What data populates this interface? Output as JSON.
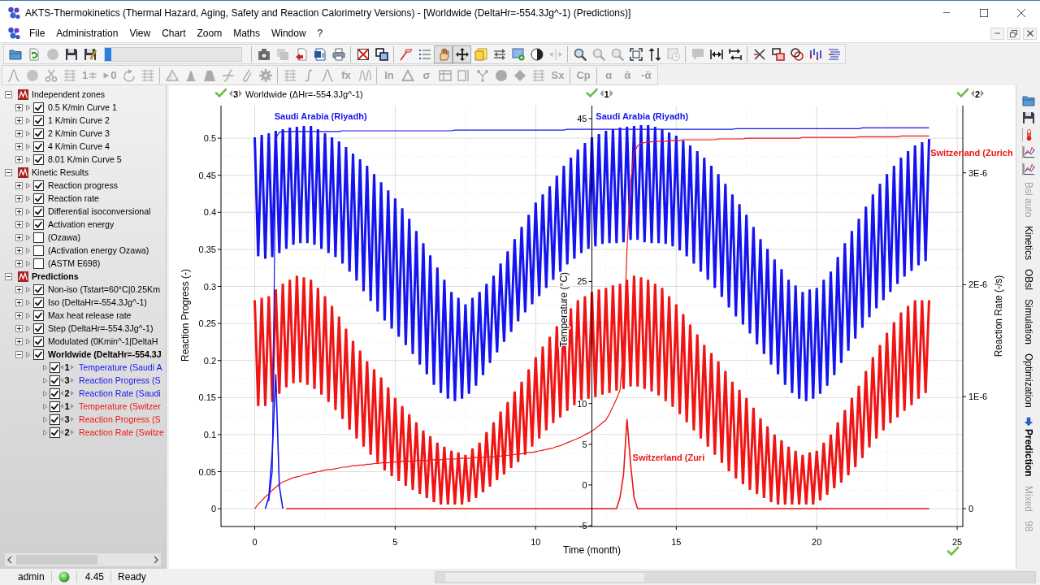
{
  "window": {
    "title": "AKTS-Thermokinetics (Thermal Hazard, Aging, Safety and Reaction Calorimetry Versions) - [Worldwide (DeltaHr=-554.3Jg^-1) (Predictions)]"
  },
  "menu": [
    "File",
    "Administration",
    "View",
    "Chart",
    "Zoom",
    "Maths",
    "Window",
    "?"
  ],
  "toolbars": [
    {
      "groups": [
        {
          "items": [
            {
              "kind": "icon",
              "disabled": false,
              "pressed": false
            },
            {
              "kind": "icon",
              "disabled": false,
              "pressed": false
            },
            {
              "kind": "icon",
              "disabled": true,
              "pressed": false
            },
            {
              "kind": "icon",
              "disabled": false,
              "pressed": false
            },
            {
              "kind": "icon",
              "disabled": false,
              "pressed": false
            }
          ],
          "progress": {
            "level": 0.05
          }
        },
        {
          "items": [
            {
              "kind": "icon",
              "disabled": false,
              "pressed": false
            },
            {
              "kind": "icon",
              "disabled": true,
              "pressed": false
            },
            {
              "kind": "icon",
              "disabled": false,
              "pressed": false
            },
            {
              "kind": "icon",
              "disabled": false,
              "pressed": false
            },
            {
              "kind": "icon",
              "disabled": false,
              "pressed": false
            }
          ]
        },
        {
          "items": [
            {
              "kind": "icon",
              "disabled": false,
              "pressed": false
            },
            {
              "kind": "icon",
              "disabled": false,
              "pressed": false
            }
          ]
        },
        {
          "items": [
            {
              "kind": "icon",
              "disabled": false,
              "pressed": false
            },
            {
              "kind": "icon",
              "disabled": false,
              "pressed": false
            },
            {
              "kind": "icon",
              "disabled": false,
              "pressed": true
            },
            {
              "kind": "icon",
              "disabled": false,
              "pressed": true
            },
            {
              "kind": "icon",
              "disabled": false,
              "pressed": false
            },
            {
              "kind": "icon",
              "disabled": false,
              "pressed": false
            },
            {
              "kind": "icon",
              "disabled": false,
              "pressed": false
            },
            {
              "kind": "icon",
              "disabled": false,
              "pressed": false
            },
            {
              "kind": "icon",
              "disabled": true,
              "pressed": false
            }
          ]
        },
        {
          "items": [
            {
              "kind": "icon",
              "disabled": false,
              "pressed": false
            },
            {
              "kind": "icon",
              "disabled": true,
              "pressed": false
            },
            {
              "kind": "icon",
              "disabled": true,
              "pressed": false
            },
            {
              "kind": "icon",
              "disabled": false,
              "pressed": false
            },
            {
              "kind": "icon",
              "disabled": false,
              "pressed": false
            },
            {
              "kind": "icon",
              "disabled": true,
              "pressed": false
            }
          ]
        },
        {
          "items": [
            {
              "kind": "icon",
              "disabled": true,
              "pressed": false
            },
            {
              "kind": "icon",
              "disabled": false,
              "pressed": false
            },
            {
              "kind": "icon",
              "disabled": false,
              "pressed": false
            }
          ]
        },
        {
          "items": [
            {
              "kind": "icon",
              "disabled": false,
              "pressed": false
            },
            {
              "kind": "icon",
              "disabled": false,
              "pressed": false
            },
            {
              "kind": "icon",
              "disabled": false,
              "pressed": false
            },
            {
              "kind": "icon",
              "disabled": false,
              "pressed": false
            },
            {
              "kind": "icon",
              "disabled": false,
              "pressed": false
            }
          ]
        }
      ]
    },
    {
      "groups": [
        {
          "items": [
            {
              "kind": "icon",
              "disabled": true,
              "pressed": false
            },
            {
              "kind": "icon",
              "disabled": true,
              "pressed": false
            },
            {
              "kind": "icon",
              "disabled": true,
              "pressed": false
            },
            {
              "kind": "icon",
              "disabled": true,
              "pressed": false
            },
            {
              "kind": "text_icon",
              "label": "1",
              "disabled": true,
              "pressed": false
            },
            {
              "kind": "icon_text",
              "label": "0",
              "disabled": true,
              "pressed": false
            },
            {
              "kind": "icon",
              "disabled": true,
              "pressed": false
            },
            {
              "kind": "icon",
              "disabled": true,
              "pressed": false
            }
          ]
        },
        {
          "items": [
            {
              "kind": "icon",
              "disabled": true,
              "pressed": false
            },
            {
              "kind": "icon",
              "disabled": true,
              "pressed": false
            },
            {
              "kind": "icon",
              "disabled": true,
              "pressed": false
            },
            {
              "kind": "icon",
              "disabled": true,
              "pressed": false
            },
            {
              "kind": "icon",
              "disabled": true,
              "pressed": false
            },
            {
              "kind": "icon",
              "disabled": true,
              "pressed": false
            }
          ]
        },
        {
          "items": [
            {
              "kind": "icon",
              "disabled": true,
              "pressed": false
            },
            {
              "kind": "icon",
              "disabled": true,
              "pressed": false
            },
            {
              "kind": "icon",
              "disabled": true,
              "pressed": false
            },
            {
              "kind": "text",
              "label": "fx",
              "disabled": true,
              "pressed": false
            },
            {
              "kind": "icon",
              "disabled": true,
              "pressed": false
            }
          ]
        },
        {
          "items": [
            {
              "kind": "text",
              "label": "ln",
              "disabled": true,
              "pressed": false
            },
            {
              "kind": "icon",
              "disabled": true,
              "pressed": false
            },
            {
              "kind": "text",
              "label": "σ",
              "disabled": true,
              "pressed": false
            },
            {
              "kind": "icon",
              "disabled": true,
              "pressed": false
            },
            {
              "kind": "icon",
              "disabled": true,
              "pressed": false
            },
            {
              "kind": "icon",
              "disabled": true,
              "pressed": false
            },
            {
              "kind": "icon",
              "disabled": true,
              "pressed": false
            },
            {
              "kind": "icon",
              "disabled": true,
              "pressed": false
            },
            {
              "kind": "icon",
              "disabled": true,
              "pressed": false
            },
            {
              "kind": "text",
              "label": "Sx",
              "disabled": true,
              "pressed": false
            }
          ]
        },
        {
          "items": [
            {
              "kind": "text",
              "label": "Cp",
              "disabled": true,
              "pressed": false
            }
          ]
        },
        {
          "items": [
            {
              "kind": "text",
              "label": "α",
              "disabled": true,
              "pressed": false
            },
            {
              "kind": "text",
              "label": "ᾱ",
              "disabled": true,
              "pressed": false
            },
            {
              "kind": "text",
              "label": "-ᾱ",
              "disabled": true,
              "pressed": false
            }
          ]
        }
      ]
    }
  ],
  "tree": [
    {
      "label": "Independent zones",
      "expanded": true,
      "active": false,
      "children": [
        {
          "label": "0.5 K/min Curve 1",
          "checked": true,
          "expanded": false,
          "active": false
        },
        {
          "label": "1 K/min Curve 2",
          "checked": true,
          "expanded": false,
          "active": false
        },
        {
          "label": "2 K/min Curve 3",
          "checked": true,
          "expanded": false,
          "active": false
        },
        {
          "label": "4 K/min Curve 4",
          "checked": true,
          "expanded": false,
          "active": false
        },
        {
          "label": "8.01 K/min Curve 5",
          "checked": true,
          "expanded": false,
          "active": false
        }
      ]
    },
    {
      "label": "Kinetic Results",
      "expanded": true,
      "active": false,
      "children": [
        {
          "label": "Reaction progress",
          "checked": true,
          "expanded": false,
          "active": false
        },
        {
          "label": "Reaction rate",
          "checked": true,
          "expanded": false,
          "active": false
        },
        {
          "label": "Differential isoconversional",
          "checked": true,
          "expanded": false,
          "active": false
        },
        {
          "label": "Activation energy",
          "checked": true,
          "expanded": false,
          "active": false
        },
        {
          "label": "(Ozawa)",
          "checked": false,
          "expanded": false,
          "active": false
        },
        {
          "label": "(Activation energy Ozawa)",
          "checked": false,
          "expanded": false,
          "active": false
        },
        {
          "label": "(ASTM E698)",
          "checked": false,
          "expanded": false,
          "active": false
        }
      ]
    },
    {
      "label": "Predictions",
      "expanded": true,
      "active": true,
      "children": [
        {
          "label": "Non-iso (Tstart=60°C|0.25Km",
          "checked": true,
          "expanded": false,
          "active": false
        },
        {
          "label": "Iso (DeltaHr=-554.3Jg^-1)",
          "checked": true,
          "expanded": false,
          "active": false
        },
        {
          "label": "Max heat release rate",
          "checked": true,
          "expanded": false,
          "active": false
        },
        {
          "label": "Step (DeltaHr=-554.3Jg^-1)",
          "checked": true,
          "expanded": false,
          "active": false
        },
        {
          "label": "Modulated (0Kmin^-1|DeltaH",
          "checked": true,
          "expanded": false,
          "active": false
        },
        {
          "label": "Worldwide (DeltaHr=-554.3J",
          "checked": true,
          "expanded": true,
          "active": true,
          "series_rows": [
            {
              "checked": true,
              "badge": "1"
            },
            {
              "checked": true,
              "badge": "3"
            },
            {
              "checked": true,
              "badge": "2"
            },
            {
              "checked": true,
              "badge": "1"
            },
            {
              "checked": true,
              "badge": "3"
            },
            {
              "checked": true,
              "badge": "2"
            }
          ]
        }
      ]
    }
  ],
  "chart": {
    "axis_badges": [
      "3",
      "1",
      "2"
    ],
    "chart_data": {
      "type": "line",
      "title": "Worldwide (ΔHr=-554.3Jg^-1)",
      "xlabel": "Time (month)",
      "ylabel": "Reaction Progress (-)",
      "y2label": "Temperature (°C)",
      "y3label": "Reaction Rate (-/s)",
      "grid": true,
      "x": [
        0,
        0.125,
        0.25,
        0.375,
        0.5,
        0.625,
        0.75,
        0.875,
        1,
        1.125,
        1.25,
        1.375,
        1.5,
        1.625,
        1.75,
        1.875,
        2,
        2.125,
        2.25,
        2.375,
        2.5,
        2.625,
        2.75,
        2.875,
        3,
        3.125,
        3.25,
        3.375,
        3.5,
        3.625,
        3.75,
        3.875,
        4,
        4.125,
        4.25,
        4.375,
        4.5,
        4.625,
        4.75,
        4.875,
        5,
        5.125,
        5.25,
        5.375,
        5.5,
        5.625,
        5.75,
        5.875,
        6,
        6.125,
        6.25,
        6.375,
        6.5,
        6.625,
        6.75,
        6.875,
        7,
        7.125,
        7.25,
        7.375,
        7.5,
        7.625,
        7.75,
        7.875,
        8,
        8.125,
        8.25,
        8.375,
        8.5,
        8.625,
        8.75,
        8.875,
        9,
        9.125,
        9.25,
        9.375,
        9.5,
        9.625,
        9.75,
        9.875,
        10,
        10.125,
        10.25,
        10.375,
        10.5,
        10.625,
        10.75,
        10.875,
        11,
        11.125,
        11.25,
        11.375,
        11.5,
        11.625,
        11.75,
        11.875,
        12,
        12.125,
        12.25,
        12.375,
        12.5,
        12.625,
        12.75,
        12.875,
        13,
        13.125,
        13.25,
        13.375,
        13.5,
        13.625,
        13.75,
        13.875,
        14,
        14.125,
        14.25,
        14.375,
        14.5,
        14.625,
        14.75,
        14.875,
        15,
        15.125,
        15.25,
        15.375,
        15.5,
        15.625,
        15.75,
        15.875,
        16,
        16.125,
        16.25,
        16.375,
        16.5,
        16.625,
        16.75,
        16.875,
        17,
        17.125,
        17.25,
        17.375,
        17.5,
        17.625,
        17.75,
        17.875,
        18,
        18.125,
        18.25,
        18.375,
        18.5,
        18.625,
        18.75,
        18.875,
        19,
        19.125,
        19.25,
        19.375,
        19.5,
        19.625,
        19.75,
        19.875,
        20,
        20.125,
        20.25,
        20.375,
        20.5,
        20.625,
        20.75,
        20.875,
        21,
        21.125,
        21.25,
        21.375,
        21.5,
        21.625,
        21.75,
        21.875,
        22,
        22.125,
        22.25,
        22.375,
        22.5,
        22.625,
        22.75,
        22.875,
        23,
        23.125,
        23.25,
        23.375,
        23.5,
        23.625,
        23.75,
        23.875,
        24
      ],
      "xlim": [
        -1.2,
        25.2
      ],
      "ylim": [
        -0.024,
        0.544
      ],
      "y2lim": [
        -5.1,
        46.6
      ],
      "y3lim": [
        -1.6e-07,
        3.6e-06
      ],
      "xticks": [
        0,
        5,
        10,
        15,
        20,
        25
      ],
      "yticks": [
        0,
        0.05,
        0.1,
        0.15,
        0.2,
        0.25,
        0.3,
        0.35,
        0.4,
        0.45,
        0.5
      ],
      "y2ticks": [
        -5,
        0,
        5,
        10,
        25,
        45
      ],
      "y3ticks": [
        0,
        {
          "value": 1e-06,
          "label": "1E-6"
        },
        {
          "value": 2e-06,
          "label": "2E-6"
        },
        {
          "value": 3e-06,
          "label": "3E-6"
        }
      ],
      "series": [
        {
          "name": "Temperature (Saudi A",
          "color": "#1414f0",
          "axis": "y2",
          "values": [
            42.7,
            28.1,
            43.0,
            27.8,
            43.2,
            28.0,
            43.5,
            28.5,
            43.7,
            29.0,
            43.9,
            29.5,
            44.0,
            29.7,
            44.1,
            29.7,
            44.1,
            29.5,
            43.7,
            29.0,
            43.2,
            28.5,
            42.7,
            28.0,
            42.2,
            27.2,
            41.5,
            26.2,
            40.7,
            25.1,
            40.0,
            23.8,
            39.2,
            22.6,
            38.2,
            21.3,
            37.2,
            20.2,
            36.2,
            19.2,
            35.2,
            18.2,
            34.0,
            17.2,
            32.7,
            16.1,
            31.2,
            14.8,
            29.7,
            13.6,
            28.2,
            12.3,
            26.7,
            11.3,
            25.2,
            10.6,
            23.7,
            10.3,
            23.0,
            10.6,
            22.2,
            11.2,
            23.0,
            12.2,
            23.7,
            13.5,
            24.7,
            15.0,
            25.7,
            16.3,
            27.2,
            17.6,
            28.7,
            18.8,
            30.2,
            20.1,
            31.7,
            21.2,
            33.2,
            22.2,
            34.7,
            23.2,
            35.7,
            24.2,
            36.7,
            25.2,
            38.0,
            26.2,
            39.2,
            27.1,
            40.2,
            27.8,
            41.2,
            28.5,
            42.0,
            29.0,
            42.7,
            29.3,
            43.1,
            29.6,
            43.5,
            29.7,
            43.7,
            29.7,
            43.9,
            29.8,
            44.0,
            30.1,
            44.1,
            30.1,
            44.2,
            29.8,
            44.2,
            29.7,
            44.0,
            29.7,
            43.7,
            29.6,
            43.3,
            29.3,
            42.9,
            28.8,
            42.3,
            28.1,
            41.7,
            27.2,
            41.0,
            26.2,
            40.2,
            25.2,
            39.2,
            24.2,
            38.2,
            23.1,
            37.0,
            21.8,
            35.7,
            20.7,
            34.5,
            19.7,
            33.2,
            18.6,
            31.7,
            17.3,
            30.2,
            16.1,
            29.0,
            14.8,
            27.7,
            13.6,
            26.5,
            12.3,
            25.2,
            11.3,
            24.5,
            10.6,
            23.7,
            10.3,
            24.0,
            10.6,
            24.2,
            11.2,
            25.2,
            12.2,
            26.2,
            13.5,
            28.0,
            15.0,
            29.7,
            16.5,
            31.2,
            18.0,
            32.7,
            19.3,
            34.2,
            20.6,
            35.7,
            21.7,
            37.0,
            22.7,
            38.2,
            23.7,
            39.2,
            24.7,
            40.2,
            25.6,
            41.0,
            26.3,
            41.7,
            27.0,
            42.1,
            27.5,
            42.5
          ]
        },
        {
          "name": "Reaction Progress (S",
          "color": "#1414f0",
          "values": [
            null,
            null,
            null,
            null,
            0.01,
            0.05,
            0.5,
            0.508,
            0.509,
            0.509,
            0.509,
            0.509,
            0.509,
            0.509,
            0.509,
            0.509,
            0.509,
            0.509,
            0.509,
            0.509,
            0.509,
            0.509,
            0.509,
            0.509,
            0.509,
            0.51,
            0.51,
            0.51,
            0.51,
            0.51,
            0.51,
            0.51,
            0.51,
            0.51,
            0.51,
            0.51,
            0.51,
            0.51,
            0.51,
            0.51,
            0.51,
            0.51,
            0.51,
            0.51,
            0.51,
            0.51,
            0.51,
            0.51,
            0.51,
            0.51,
            0.51,
            0.51,
            0.51,
            0.51,
            0.51,
            0.51,
            0.51,
            0.511,
            0.511,
            0.511,
            0.511,
            0.511,
            0.511,
            0.511,
            0.511,
            0.511,
            0.511,
            0.511,
            0.511,
            0.511,
            0.511,
            0.511,
            0.511,
            0.511,
            0.511,
            0.511,
            0.511,
            0.511,
            0.511,
            0.511,
            0.511,
            0.511,
            0.511,
            0.511,
            0.511,
            0.511,
            0.511,
            0.511,
            0.511,
            0.512,
            0.512,
            0.512,
            0.512,
            0.512,
            0.512,
            0.512,
            0.512,
            0.512,
            0.512,
            0.512,
            0.512,
            0.512,
            0.512,
            0.512,
            0.512,
            0.512,
            0.512,
            0.512,
            0.512,
            0.512,
            0.512,
            0.512,
            0.512,
            0.512,
            0.512,
            0.512,
            0.512,
            0.512,
            0.512,
            0.512,
            0.512,
            0.512,
            0.512,
            0.512,
            0.512,
            0.512,
            0.512,
            0.512,
            0.512,
            0.512,
            0.512,
            0.512,
            0.512,
            0.512,
            0.512,
            0.512,
            0.512,
            0.513,
            0.513,
            0.513,
            0.513,
            0.513,
            0.513,
            0.513,
            0.513,
            0.513,
            0.513,
            0.513,
            0.513,
            0.513,
            0.513,
            0.513,
            0.513,
            0.513,
            0.513,
            0.513,
            0.513,
            0.513,
            0.513,
            0.513,
            0.513,
            0.513,
            0.513,
            0.513,
            0.513,
            0.513,
            0.513,
            0.513,
            0.513,
            0.513,
            0.513,
            0.513,
            0.513,
            0.514,
            0.514,
            0.514,
            0.514,
            0.514,
            0.514,
            0.514,
            0.514,
            0.514,
            0.514,
            0.514,
            0.514,
            0.514,
            0.514,
            0.514,
            0.514,
            0.514,
            0.514,
            0.514,
            0.514
          ]
        },
        {
          "name": "Reaction Rate (Saudi",
          "color": "#1414f0",
          "axis": "y3",
          "values": [
            null,
            null,
            null,
            0,
            1e-07,
            5e-07,
            1.2e-06,
            2e-07,
            0,
            null,
            null,
            null,
            null,
            null,
            null,
            null,
            null,
            null,
            null,
            null,
            null,
            null,
            null,
            null,
            null,
            null,
            null,
            null,
            null,
            null,
            null,
            null,
            null,
            null,
            null,
            null,
            null,
            null,
            null,
            null,
            null,
            null,
            null,
            null,
            null,
            null,
            null,
            null,
            null,
            null,
            null,
            null,
            null,
            null,
            null,
            null,
            null,
            null,
            null,
            null,
            null,
            null,
            null,
            null,
            null,
            null,
            null,
            null,
            null,
            null,
            null,
            null,
            null,
            null,
            null,
            null,
            null,
            null,
            null,
            null,
            null,
            null,
            null,
            null,
            null,
            null,
            null,
            null,
            null,
            null,
            null,
            null,
            null,
            null,
            null,
            null,
            null,
            null,
            null,
            null,
            null,
            null,
            null,
            null,
            null,
            null,
            null,
            null,
            null,
            null,
            null,
            null,
            null,
            null,
            null,
            null,
            null,
            null,
            null,
            null,
            null,
            null,
            null,
            null,
            null,
            null,
            null,
            null,
            null,
            null,
            null,
            null,
            null,
            null,
            null,
            null,
            null,
            null,
            null,
            null,
            null,
            null,
            null,
            null,
            null,
            null,
            null,
            null,
            null,
            null,
            null,
            null,
            null,
            null,
            null,
            null,
            null,
            null,
            null,
            null,
            null,
            null,
            null,
            null,
            null,
            null,
            null,
            null,
            null,
            null,
            null,
            null,
            null,
            null,
            null,
            null,
            null,
            null,
            null,
            null,
            null,
            null,
            null,
            null,
            null,
            null,
            null,
            null,
            null,
            null,
            null,
            null,
            null
          ]
        },
        {
          "name": "Temperature (Switzer",
          "color": "#f01414",
          "axis": "y2",
          "values": [
            22.7,
            9.7,
            23.0,
            9.7,
            23.2,
            10.2,
            24.0,
            11.2,
            24.7,
            12.0,
            25.2,
            12.5,
            25.7,
            12.6,
            25.5,
            12.3,
            25.2,
            11.8,
            24.2,
            11.1,
            23.2,
            10.2,
            22.0,
            9.2,
            20.7,
            8.1,
            19.2,
            6.8,
            17.7,
            5.7,
            16.5,
            4.7,
            15.2,
            3.7,
            14.2,
            2.7,
            13.2,
            1.8,
            12.0,
            1.1,
            10.7,
            0.5,
            9.7,
            -0.1,
            8.7,
            -0.6,
            7.7,
            -1.1,
            6.7,
            -1.6,
            6.0,
            -2.1,
            5.2,
            -2.4,
            4.7,
            -2.4,
            4.2,
            -2.4,
            4.0,
            -2.4,
            3.7,
            -2.1,
            4.5,
            -1.6,
            5.2,
            -0.9,
            6.5,
            -0.2,
            7.7,
            0.6,
            9.0,
            1.3,
            10.2,
            2.1,
            11.5,
            2.8,
            12.7,
            3.7,
            14.2,
            4.7,
            15.7,
            5.7,
            17.0,
            6.7,
            18.2,
            7.6,
            19.5,
            8.3,
            20.7,
            9.1,
            21.7,
            9.8,
            22.7,
            10.3,
            23.2,
            10.6,
            23.7,
            10.8,
            24.0,
            11.1,
            24.2,
            11.3,
            24.5,
            11.6,
            24.7,
            11.8,
            25.2,
            12.1,
            25.7,
            12.1,
            25.5,
            11.8,
            25.2,
            11.5,
            24.7,
            11.0,
            24.2,
            10.3,
            23.2,
            9.6,
            22.2,
            8.7,
            21.0,
            7.7,
            19.7,
            6.7,
            18.5,
            5.7,
            17.2,
            4.7,
            16.2,
            3.7,
            15.2,
            2.7,
            14.0,
            1.7,
            12.7,
            0.8,
            11.7,
            0.1,
            10.7,
            -0.6,
            9.5,
            -1.1,
            8.2,
            -1.6,
            7.2,
            -2.1,
            6.2,
            -2.4,
            5.5,
            -2.4,
            4.7,
            -2.4,
            4.2,
            -2.4,
            3.7,
            -2.4,
            4.0,
            -2.4,
            4.2,
            -1.9,
            5.2,
            -1.2,
            6.2,
            -0.4,
            7.7,
            0.3,
            9.2,
            1.2,
            10.7,
            2.2,
            12.2,
            3.3,
            14.0,
            4.6,
            15.7,
            5.7,
            17.2,
            6.7,
            18.7,
            7.6,
            20.0,
            8.3,
            21.2,
            9.1,
            22.0,
            9.8,
            22.7,
            10.6,
            22.7,
            11.3,
            22.7
          ]
        },
        {
          "name": "Reaction Progress (S",
          "color": "#f01414",
          "values": [
            0,
            0.006,
            0.011,
            0.016,
            0.02,
            0.025,
            0.029,
            0.033,
            0.036,
            0.038,
            0.04,
            0.042,
            0.043,
            0.044,
            0.046,
            0.047,
            0.048,
            0.049,
            0.05,
            0.051,
            0.052,
            0.053,
            0.053,
            0.054,
            0.055,
            0.056,
            0.056,
            0.057,
            0.058,
            0.058,
            0.059,
            0.059,
            0.06,
            0.06,
            0.061,
            0.061,
            0.062,
            0.062,
            0.062,
            0.063,
            0.063,
            0.063,
            0.064,
            0.064,
            0.064,
            0.064,
            0.065,
            0.065,
            0.065,
            0.065,
            0.066,
            0.066,
            0.066,
            0.066,
            0.067,
            0.067,
            0.067,
            0.067,
            0.068,
            0.068,
            0.068,
            0.068,
            0.069,
            0.069,
            0.069,
            0.069,
            0.07,
            0.07,
            0.07,
            0.071,
            0.071,
            0.072,
            0.072,
            0.073,
            0.073,
            0.074,
            0.074,
            0.075,
            0.076,
            0.076,
            0.077,
            0.078,
            0.079,
            0.08,
            0.081,
            0.082,
            0.084,
            0.085,
            0.087,
            0.089,
            0.091,
            0.093,
            0.095,
            0.097,
            0.1,
            0.102,
            0.105,
            0.108,
            0.112,
            0.116,
            0.12,
            0.128,
            0.138,
            0.148,
            0.16,
            0.22,
            0.35,
            0.44,
            0.48,
            0.49,
            0.493,
            0.494,
            0.495,
            0.495,
            0.496,
            0.496,
            0.496,
            0.496,
            0.497,
            0.497,
            0.497,
            0.497,
            0.498,
            0.498,
            0.498,
            0.498,
            0.498,
            0.498,
            0.498,
            0.498,
            0.498,
            0.498,
            0.499,
            0.499,
            0.499,
            0.499,
            0.499,
            0.499,
            0.499,
            0.499,
            0.5,
            0.5,
            0.5,
            0.5,
            0.5,
            0.5,
            0.5,
            0.5,
            0.5,
            0.5,
            0.5,
            0.5,
            0.5,
            0.5,
            0.5,
            0.5,
            0.501,
            0.501,
            0.501,
            0.501,
            0.501,
            0.501,
            0.501,
            0.501,
            0.501,
            0.501,
            0.501,
            0.501,
            0.501,
            0.501,
            0.501,
            0.501,
            0.502,
            0.502,
            0.502,
            0.502,
            0.502,
            0.502,
            0.502,
            0.502,
            0.502,
            0.502,
            0.502,
            0.502,
            0.503,
            0.503,
            0.503,
            0.503,
            0.503,
            0.503,
            0.503,
            0.503,
            0.503
          ]
        },
        {
          "name": "Reaction Rate (Switze",
          "color": "#f01414",
          "axis": "y3",
          "values": [
            null,
            null,
            null,
            null,
            null,
            null,
            null,
            null,
            null,
            0,
            0,
            0,
            0,
            0,
            0,
            0,
            0,
            0,
            0,
            0,
            0,
            0,
            0,
            0,
            0,
            0,
            0,
            0,
            0,
            0,
            0,
            0,
            0,
            0,
            0,
            0,
            0,
            0,
            0,
            0,
            0,
            0,
            0,
            0,
            0,
            0,
            0,
            0,
            0,
            0,
            0,
            0,
            0,
            0,
            0,
            0,
            0,
            0,
            0,
            0,
            0,
            0,
            0,
            0,
            0,
            0,
            0,
            0,
            0,
            0,
            0,
            0,
            0,
            0,
            0,
            0,
            0,
            0,
            0,
            0,
            0,
            0,
            0,
            0,
            0,
            0,
            0,
            0,
            0,
            0,
            0,
            0,
            0,
            0,
            0,
            0,
            0,
            0,
            0,
            0,
            0,
            0,
            0,
            0,
            1e-07,
            3e-07,
            8e-07,
            4e-07,
            1e-07,
            0,
            0,
            0,
            0,
            0,
            0,
            0,
            0,
            0,
            0,
            0,
            0,
            0,
            0,
            0,
            0,
            0,
            0,
            0,
            0,
            0,
            0,
            0,
            0,
            0,
            0,
            0,
            0,
            0,
            0,
            0,
            0,
            0,
            0,
            0,
            0,
            0,
            0,
            0,
            0,
            0,
            0,
            0,
            0,
            0,
            0,
            0,
            0,
            0,
            0,
            0,
            0,
            0,
            0,
            0,
            0,
            0,
            0,
            0,
            0,
            0,
            0,
            0,
            0,
            0,
            0,
            0,
            0,
            0,
            0,
            0,
            0,
            0,
            0,
            0,
            0,
            0,
            0,
            0,
            0,
            0,
            0,
            0,
            0
          ]
        }
      ],
      "annotations": [
        "Saudi Arabia (Riyadh)",
        "Saudi Arabia (Riyadh)",
        "Switzerland (Zurich",
        "Switzerland (Zuri"
      ]
    }
  },
  "side_tabs": [
    {
      "label": "Bsl auto",
      "selected": false,
      "disabled": true
    },
    {
      "label": "Kinetics",
      "selected": false,
      "disabled": false
    },
    {
      "label": "OBsl",
      "selected": false,
      "disabled": false
    },
    {
      "label": "Simulation",
      "selected": false,
      "disabled": false
    },
    {
      "label": "Optimization",
      "selected": false,
      "disabled": false
    },
    {
      "label": "Prediction",
      "selected": true,
      "disabled": false
    },
    {
      "label": "Mixed",
      "selected": false,
      "disabled": true
    },
    {
      "label": "98",
      "selected": false,
      "disabled": true
    }
  ],
  "status_bar": {
    "user": "admin",
    "number": "4.45",
    "message": "Ready"
  }
}
